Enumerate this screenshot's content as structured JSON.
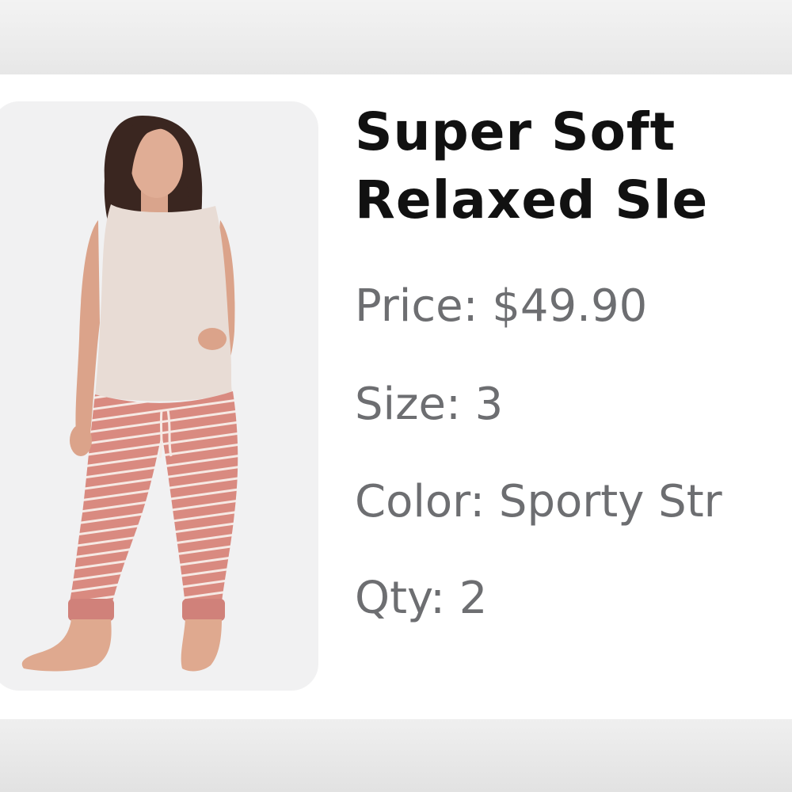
{
  "product": {
    "title_line1": "Super Soft",
    "title_line2": "Relaxed Sle",
    "image_alt": "Model wearing sleeveless oatmeal top and pink striped jogger pants"
  },
  "details": {
    "price": {
      "label": "Price:",
      "value": "$49.90"
    },
    "size": {
      "label": "Size:",
      "value": "3"
    },
    "color": {
      "label": "Color:",
      "value": "Sporty Str"
    },
    "qty": {
      "label": "Qty:",
      "value": "2"
    }
  },
  "colors": {
    "title": "#111111",
    "detail_text": "#6d6e71",
    "card_bg": "#ffffff",
    "page_bg": "#e6e6e6",
    "pants_pink": "#d98a80",
    "top_oatmeal": "#e8dcd5"
  }
}
